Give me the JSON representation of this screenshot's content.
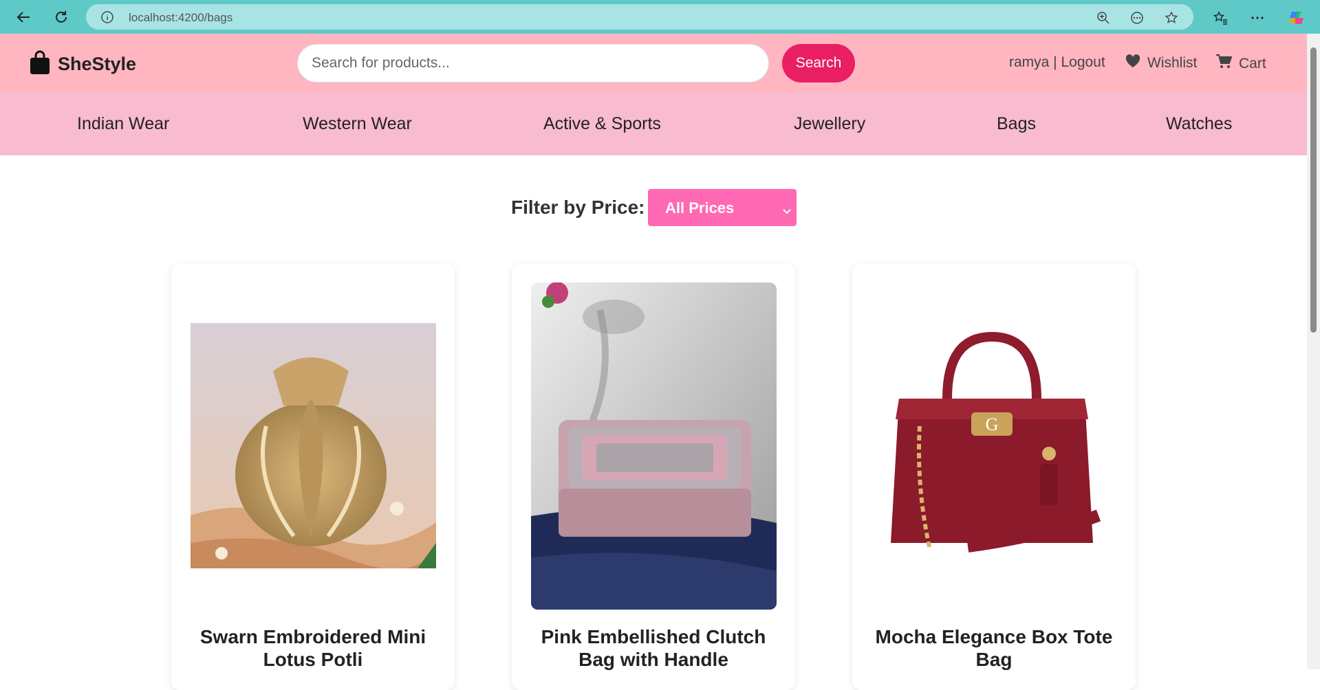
{
  "browser": {
    "url_host": "localhost",
    "url_path": ":4200/bags"
  },
  "header": {
    "brand": "SheStyle",
    "search_placeholder": "Search for products...",
    "search_button": "Search",
    "user": "ramya | Logout",
    "wishlist": "Wishlist",
    "cart": "Cart"
  },
  "categories": [
    "Indian Wear",
    "Western Wear",
    "Active & Sports",
    "Jewellery",
    "Bags",
    "Watches"
  ],
  "filter": {
    "label": "Filter by Price:",
    "selected": "All Prices"
  },
  "products": [
    {
      "name": "Swarn Embroidered Mini Lotus Potli"
    },
    {
      "name": "Pink Embellished Clutch Bag with Handle"
    },
    {
      "name": "Mocha Elegance Box Tote Bag"
    }
  ],
  "colors": {
    "header_bg": "#ffb6c1",
    "nav_bg": "#f8bbd0",
    "accent": "#e91e63",
    "select_bg": "#ff69b4"
  }
}
